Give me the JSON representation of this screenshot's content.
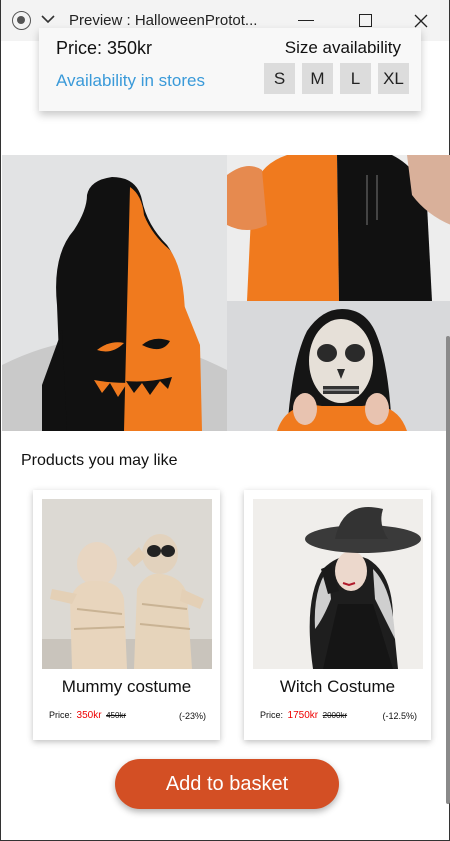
{
  "window": {
    "title": "Preview : HalloweenProtot..."
  },
  "info": {
    "price": "Price: 350kr",
    "size_title": "Size availability",
    "stores_link": "Availability in stores",
    "sizes": [
      "S",
      "M",
      "L",
      "XL"
    ]
  },
  "recommendations": {
    "title": "Products you may like",
    "products": [
      {
        "name": "Mummy costume",
        "price_label": "Price:",
        "price_now": "350kr",
        "price_old": "450kr",
        "discount": "(-23%)"
      },
      {
        "name": "Witch Costume",
        "price_label": "Price:",
        "price_now": "1750kr",
        "price_old": "2000kr",
        "discount": "(-12.5%)"
      }
    ]
  },
  "cta": {
    "label": "Add to basket"
  },
  "colors": {
    "accent": "#d34f24",
    "link": "#3a9ad9",
    "sale": "#ee0000"
  },
  "icons": [
    "record-icon",
    "chevron-down-icon",
    "minimize-icon",
    "maximize-icon",
    "close-icon"
  ]
}
